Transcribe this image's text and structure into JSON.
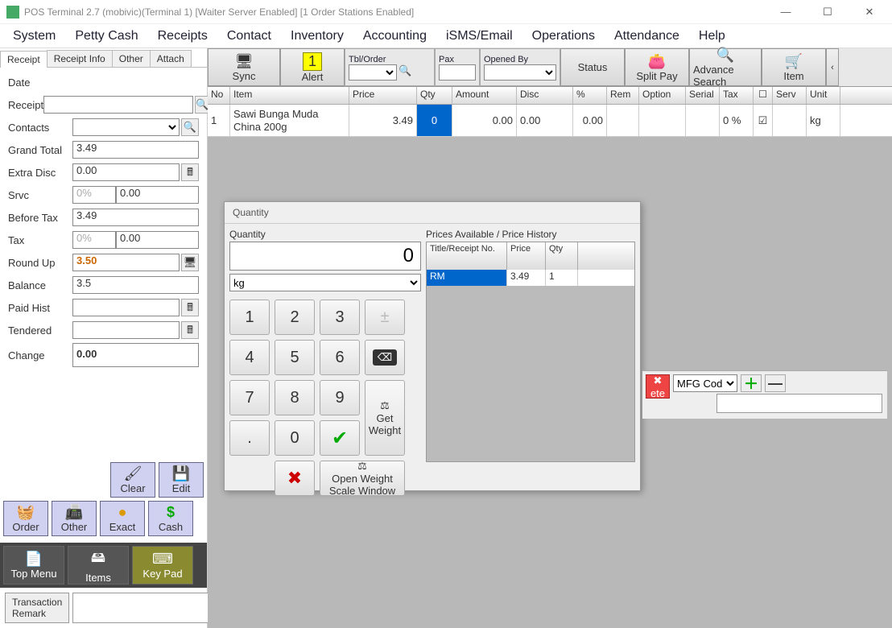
{
  "window": {
    "title": "POS Terminal 2.7 (mobivic)(Terminal 1) [Waiter Server Enabled] [1 Order Stations Enabled]"
  },
  "menu": [
    "System",
    "Petty Cash",
    "Receipts",
    "Contact",
    "Inventory",
    "Accounting",
    "iSMS/Email",
    "Operations",
    "Attendance",
    "Help"
  ],
  "tabs": [
    "Receipt",
    "Receipt Info",
    "Other",
    "Attach"
  ],
  "form": {
    "date_label": "Date",
    "receipt_label": "Receipt",
    "receipt_value": "",
    "contacts_label": "Contacts",
    "grand_total_label": "Grand Total",
    "grand_total_value": "3.49",
    "extra_disc_label": "Extra Disc",
    "extra_disc_value": "0.00",
    "srvc_label": "Srvc",
    "srvc_pct": "0%",
    "srvc_value": "0.00",
    "before_tax_label": "Before Tax",
    "before_tax_value": "3.49",
    "tax_label": "Tax",
    "tax_pct": "0%",
    "tax_value": "0.00",
    "round_up_label": "Round Up",
    "round_up_value": "3.50",
    "balance_label": "Balance",
    "balance_value": "3.5",
    "paid_hist_label": "Paid Hist",
    "paid_hist_value": "",
    "tendered_label": "Tendered",
    "tendered_value": "",
    "change_label": "Change",
    "change_value": "0.00"
  },
  "buttons": {
    "clear": "Clear",
    "edit": "Edit",
    "order": "Order",
    "other": "Other",
    "exact": "Exact",
    "cash": "Cash",
    "top_menu": "Top Menu",
    "items": "Items",
    "key_pad": "Key Pad",
    "transaction_remark": "Transaction Remark"
  },
  "toolbar": {
    "sync": "Sync",
    "alert": "Alert",
    "alert_badge": "1",
    "tbl_order": "Tbl/Order",
    "pax": "Pax",
    "opened_by": "Opened By",
    "status": "Status",
    "split_pay": "Split Pay",
    "adv_search": "Advance Search",
    "item": "Item"
  },
  "grid": {
    "headers": [
      "No",
      "Item",
      "Price",
      "Qty",
      "Amount",
      "Disc",
      "%",
      "Rem",
      "Option",
      "Serial",
      "Tax",
      "",
      "Serv",
      "Unit"
    ],
    "row": {
      "no": "1",
      "item": "Sawi Bunga Muda China 200g",
      "price": "3.49",
      "qty": "0",
      "amount": "0.00",
      "disc": "0.00",
      "pct": "0.00",
      "rem": "",
      "option": "",
      "serial": "",
      "tax": "0 %",
      "check": "☑",
      "serv": "",
      "unit": "kg"
    }
  },
  "qty_dialog": {
    "title": "Quantity",
    "group": "Quantity",
    "value": "0",
    "unit": "kg",
    "prices_label": "Prices Available / Price History",
    "pt_headers": [
      "Title/Receipt No.",
      "Price",
      "Qty"
    ],
    "pt_row": {
      "title": "RM",
      "price": "3.49",
      "qty": "1"
    },
    "keys": {
      "k1": "1",
      "k2": "2",
      "k3": "3",
      "k4": "4",
      "k5": "5",
      "k6": "6",
      "k7": "7",
      "k8": "8",
      "k9": "9",
      "k0": "0",
      "kdot": ".",
      "kplusminus": "±"
    },
    "get_weight": "Get Weight",
    "open_scale": "Open Weight Scale Window"
  },
  "mfg": {
    "delete": "ete",
    "combo": "MFG Cod"
  }
}
